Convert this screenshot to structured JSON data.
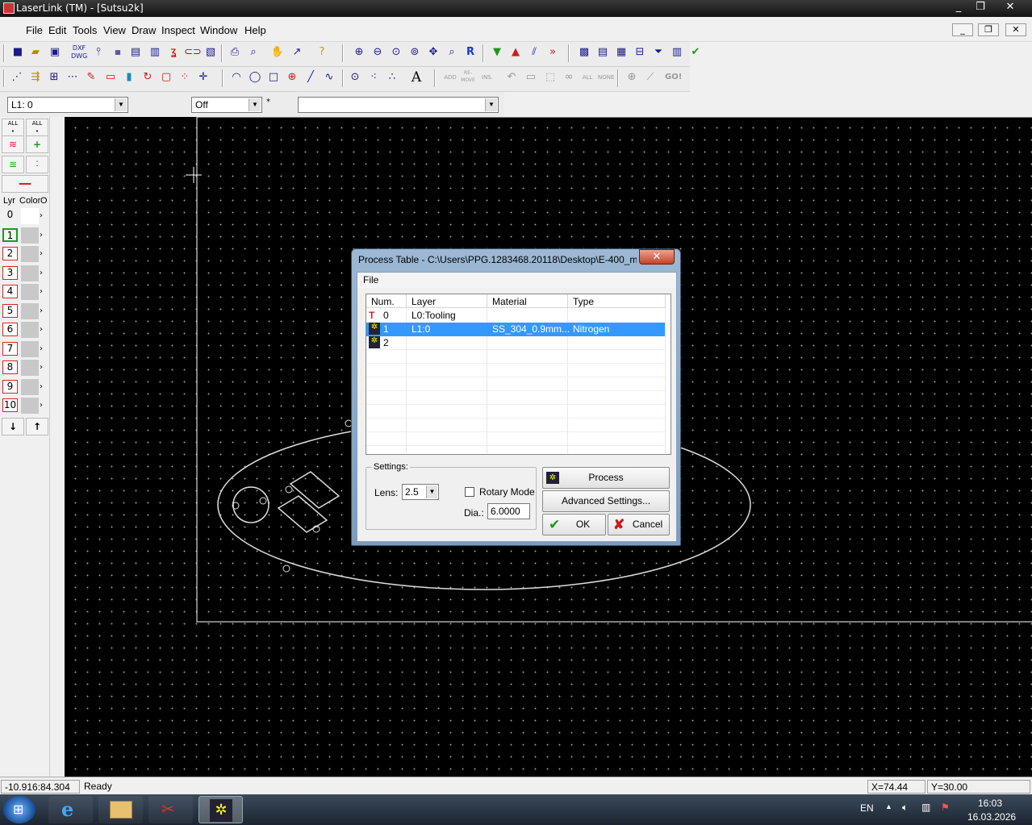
{
  "window": {
    "title": "LaserLink (TM) - [Sutsu2k]",
    "min": "_",
    "max": "❐",
    "close": "✕"
  },
  "menu": {
    "items": [
      "File",
      "Edit",
      "Tools",
      "View",
      "Draw",
      "Inspect",
      "Window",
      "Help"
    ],
    "mdi_min": "_",
    "mdi_restore": "❐",
    "mdi_close": "✕"
  },
  "toolbar": {
    "combo_layer": "L1: 0",
    "combo_snap": "Off",
    "combo_extra": "",
    "labels": {
      "add": "ADD",
      "remove": "RE-MOVE",
      "ins": "INS.",
      "all": "ALL",
      "none": "NONE",
      "go": "GO!"
    }
  },
  "layers_panel": {
    "header_lyr": "Lyr",
    "header_color": "Color",
    "header_extra": "O",
    "rows": [
      "0",
      "1",
      "2",
      "3",
      "4",
      "5",
      "6",
      "7",
      "8",
      "9",
      "10"
    ],
    "selected": "1"
  },
  "dialog": {
    "title": "Process Table - C:\\Users\\PPG.1283468.20118\\Desktop\\E-400_m...",
    "close_label": "✕",
    "menu_file": "File",
    "columns": [
      "Num.",
      "Layer",
      "Material",
      "Type"
    ],
    "rows": [
      {
        "num": "0",
        "layer": "L0:Tooling",
        "material": "",
        "type": ""
      },
      {
        "num": "1",
        "layer": "L1:0",
        "material": "SS_304_0.9mm...",
        "type": "Nitrogen"
      },
      {
        "num": "2",
        "layer": "",
        "material": "",
        "type": ""
      }
    ],
    "selected_row": 1,
    "settings_label": "Settings:",
    "lens_label": "Lens:",
    "lens_value": "2.5",
    "rotary_label": "Rotary Mode",
    "rotary_checked": false,
    "dia_label": "Dia.:",
    "dia_value": "6.0000",
    "process_button": "Process",
    "advanced_button": "Advanced Settings...",
    "ok_button": "OK",
    "cancel_button": "Cancel"
  },
  "status": {
    "coords": "-10.916:84.304",
    "message": "Ready",
    "x": "X=74.44",
    "y": "Y=30.00"
  },
  "taskbar": {
    "lang": "EN",
    "time": "16:03",
    "date": "16.03.2026"
  },
  "colors": {
    "selection": "#3399ff",
    "canvas": "#000000",
    "layer_border": "#dd2222"
  }
}
